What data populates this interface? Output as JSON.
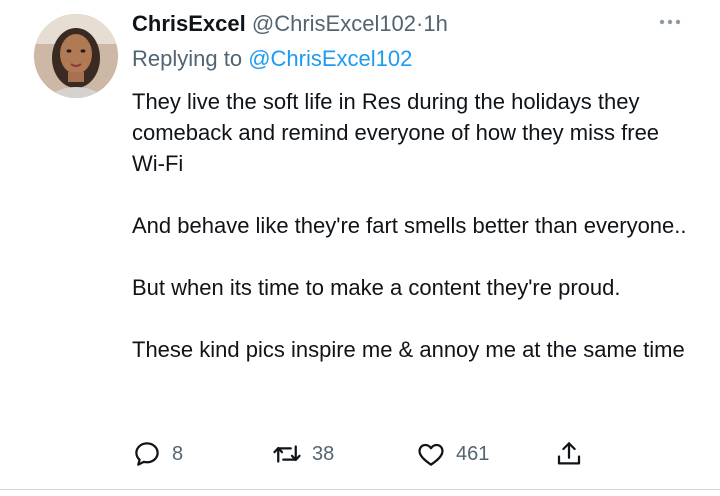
{
  "tweet": {
    "author_name": "ChrisExcel",
    "author_handle": "@ChrisExcel102",
    "separator": "·",
    "time": "1h",
    "replying_prefix": "Replying to",
    "replying_to": "@ChrisExcel102",
    "paragraphs": [
      "They live the soft life in Res during the holidays they comeback and remind everyone of how they miss free Wi-Fi",
      "And behave like they're fart smells better than everyone..",
      "But when its time to make a content they're proud.",
      "These kind pics inspire me & annoy me at the same time"
    ],
    "stats": {
      "replies": "8",
      "retweets": "38",
      "likes": "461"
    },
    "icons": {
      "more": "more-horizontal-icon",
      "reply": "reply-bubble-icon",
      "retweet": "retweet-icon",
      "like": "heart-icon",
      "share": "share-upload-icon"
    },
    "colors": {
      "link": "#1d9bf0",
      "secondary_text": "#536471",
      "primary_text": "#0f1419"
    }
  }
}
